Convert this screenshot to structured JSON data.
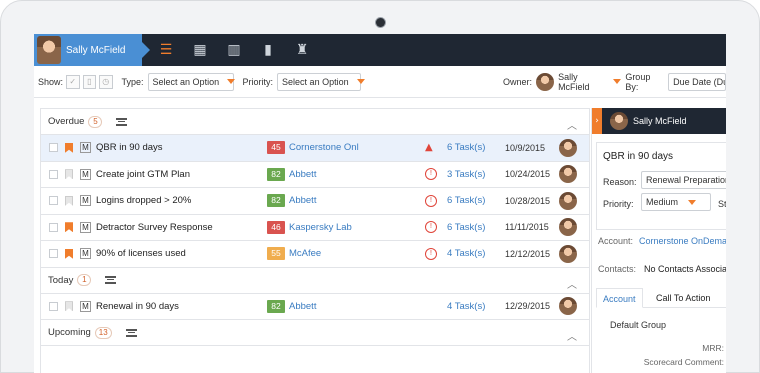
{
  "header": {
    "user_name": "Sally McField",
    "nav_icons": [
      "list-icon",
      "calendar-icon",
      "chart-icon",
      "columns-icon",
      "trophy-icon"
    ]
  },
  "filters": {
    "show_label": "Show:",
    "type_label": "Type:",
    "type_value": "Select an Option",
    "priority_label": "Priority:",
    "priority_value": "Select an Option",
    "owner_label": "Owner:",
    "owner_value": "Sally McField",
    "group_by_label": "Group By:",
    "group_by_value": "Due Date (Due"
  },
  "groups": [
    {
      "label": "Overdue",
      "count": "5",
      "rows": [
        {
          "title": "QBR in 90 days",
          "flagged": true,
          "score": "45",
          "score_color": "#d9534f",
          "account": "Cornerstone Onl",
          "alert": "warn",
          "tasks": "6 Task(s)",
          "date": "10/9/2015",
          "selected": true
        },
        {
          "title": "Create joint GTM Plan",
          "flagged": false,
          "score": "82",
          "score_color": "#6aa84f",
          "account": "Abbett",
          "alert": "clock",
          "tasks": "3 Task(s)",
          "date": "10/24/2015",
          "selected": false
        },
        {
          "title": "Logins dropped > 20%",
          "flagged": false,
          "score": "82",
          "score_color": "#6aa84f",
          "account": "Abbett",
          "alert": "clock",
          "tasks": "6 Task(s)",
          "date": "10/28/2015",
          "selected": false
        },
        {
          "title": "Detractor Survey Response",
          "flagged": true,
          "score": "46",
          "score_color": "#d9534f",
          "account": "Kaspersky Lab",
          "alert": "clock",
          "tasks": "6 Task(s)",
          "date": "11/11/2015",
          "selected": false
        },
        {
          "title": "90% of licenses used",
          "flagged": true,
          "score": "55",
          "score_color": "#f0ad4e",
          "account": "McAfee",
          "alert": "clock",
          "tasks": "4 Task(s)",
          "date": "12/12/2015",
          "selected": false
        }
      ]
    },
    {
      "label": "Today",
      "count": "1",
      "rows": [
        {
          "title": "Renewal in 90 days",
          "flagged": false,
          "score": "82",
          "score_color": "#6aa84f",
          "account": "Abbett",
          "alert": "none",
          "tasks": "4 Task(s)",
          "date": "12/29/2015",
          "selected": false
        }
      ]
    },
    {
      "label": "Upcoming",
      "count": "13",
      "rows": []
    }
  ],
  "row_type_letter": "M",
  "side_panel": {
    "user_name": "Sally McField",
    "expand_glyph": "›",
    "title": "QBR in 90 days",
    "reason_label": "Reason:",
    "reason_value": "Renewal Preparation",
    "priority_label": "Priority:",
    "priority_value": "Medium",
    "status_abbrev": "St",
    "account_label": "Account:",
    "account_value": "Cornerstone OnDemand",
    "contacts_label": "Contacts:",
    "contacts_value": "No Contacts Associated",
    "tab_account": "Account",
    "tab_call": "Call To Action",
    "group_label": "Default Group",
    "mrr_label": "MRR:",
    "scorecard_label": "Scorecard Comment:"
  }
}
